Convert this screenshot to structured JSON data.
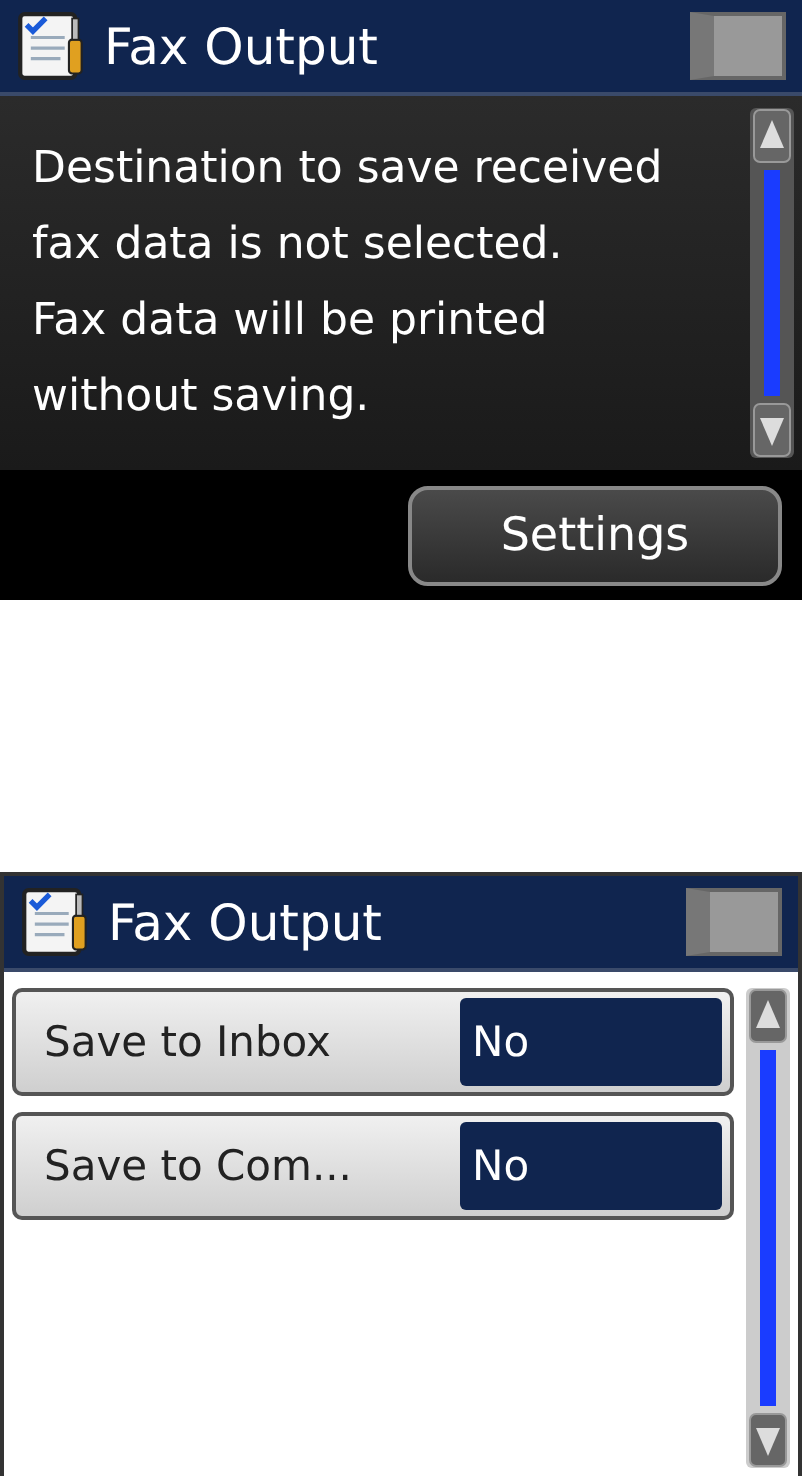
{
  "screens": [
    {
      "kind": "message",
      "title": "Fax Output",
      "message_lines": [
        "Destination to save received",
        "fax data is not selected.",
        "Fax data will be printed",
        "without saving."
      ],
      "button": "Settings"
    },
    {
      "kind": "settings",
      "title": "Fax Output",
      "items": [
        {
          "label": "Save to Inbox",
          "value": "No"
        },
        {
          "label": "Save to Com...",
          "value": "No"
        }
      ]
    }
  ]
}
